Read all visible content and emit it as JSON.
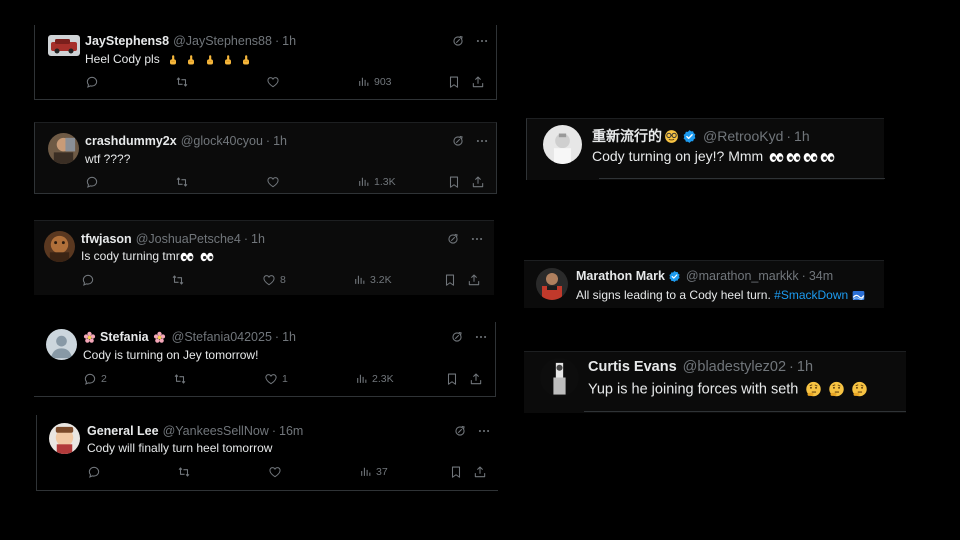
{
  "tweets": [
    {
      "id": "jay",
      "name": "JayStephens8",
      "handle": "@JayStephens88",
      "time": "1h",
      "text": "Heel Cody pls",
      "emoji_count": 5,
      "views": "903",
      "likes": "",
      "replies": ""
    },
    {
      "id": "crash",
      "name": "crashdummy2x",
      "handle": "@glock40cyou",
      "time": "1h",
      "text": "wtf ????",
      "views": "1.3K",
      "likes": "",
      "replies": ""
    },
    {
      "id": "tfw",
      "name": "tfwjason",
      "handle": "@JoshuaPetsche4",
      "time": "1h",
      "text": "Is cody turning tmr",
      "views": "3.2K",
      "likes": "8",
      "replies": ""
    },
    {
      "id": "stef",
      "name": "Stefania",
      "handle": "@Stefania042025",
      "time": "1h",
      "text": "Cody is turning on Jey tomorrow!",
      "views": "2.3K",
      "likes": "1",
      "replies": "2"
    },
    {
      "id": "gen",
      "name": "General Lee",
      "handle": "@YankeesSellNow",
      "time": "16m",
      "text": "Cody will finally turn heel tomorrow",
      "views": "37",
      "likes": "",
      "replies": ""
    },
    {
      "id": "retro",
      "name": "重新流行的",
      "handle": "@RetrooKyd",
      "time": "1h",
      "text": "Cody turning on jey!? Mmm"
    },
    {
      "id": "mark",
      "name": "Marathon Mark",
      "handle": "@marathon_markkk",
      "time": "34m",
      "text": "All signs leading to a Cody heel turn.",
      "hashtag": "#SmackDown"
    },
    {
      "id": "curtis",
      "name": "Curtis Evans",
      "handle": "@bladestylez02",
      "time": "1h",
      "text": "Yup is he joining forces with seth"
    }
  ],
  "separator": "·",
  "colors": {
    "background": "#000000",
    "text": "#e7e9ea",
    "muted": "#71767b",
    "accent": "#1d9bf0",
    "border": "#2f3336"
  },
  "icons": {
    "reply": "reply-icon",
    "retweet": "retweet-icon",
    "like": "heart-icon",
    "views": "views-icon",
    "bookmark": "bookmark-icon",
    "share": "share-icon",
    "grok": "grok-icon",
    "more": "more-icon",
    "verified": "verified-badge-icon"
  }
}
